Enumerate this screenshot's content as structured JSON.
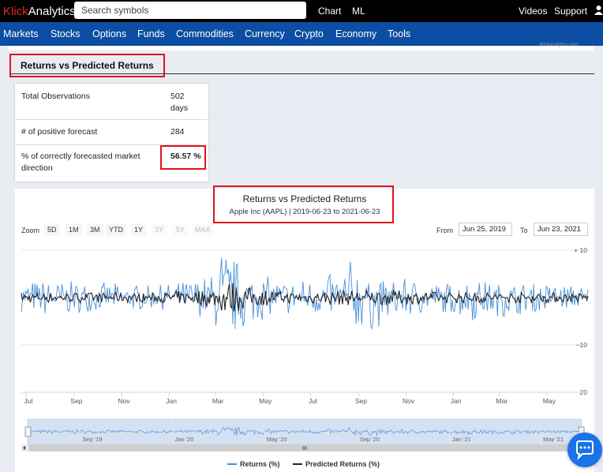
{
  "header": {
    "logo_prefix": "Klick",
    "logo_suffix": "Analytics",
    "search_placeholder": "Search symbols",
    "nav_chart": "Chart",
    "nav_ml": "ML",
    "nav_videos": "Videos",
    "nav_support": "Support",
    "brand_color": "#e0291b"
  },
  "menu": {
    "items": [
      "Markets",
      "Stocks",
      "Options",
      "Funds",
      "Commodities",
      "Currency",
      "Crypto",
      "Economy",
      "Tools"
    ],
    "bg_color": "#0b4ea3"
  },
  "watermark": "klickanalytics.com",
  "section": {
    "title": "Returns vs Predicted Returns"
  },
  "stats": {
    "rows": [
      {
        "label": "Total Observations",
        "value": "502 days"
      },
      {
        "label": "# of positive forecast",
        "value": "284"
      },
      {
        "label": "% of correctly forecasted market direction",
        "value": "56.57 %"
      }
    ]
  },
  "controls": {
    "zoom_label": "Zoom",
    "zoom_buttons": [
      "5D",
      "1M",
      "3M",
      "YTD",
      "1Y",
      "3Y",
      "5Y",
      "MAX"
    ],
    "from_label": "From",
    "from_date": "Jun 25, 2019",
    "to_label": "To",
    "to_date": "Jun 23, 2021"
  },
  "chart_data": {
    "type": "line",
    "title": "Returns vs Predicted Returns",
    "subtitle": "Apple Inc (AAPL) | 2019-06-23 to 2021-06-23",
    "xlabel": "",
    "ylabel": "",
    "ylim": [
      -20,
      12
    ],
    "y_ticks": [
      10,
      -10,
      -20
    ],
    "y_tick_labels": [
      "+ 10",
      "−10",
      "−20"
    ],
    "x_tick_labels": [
      "Jul",
      "Sep",
      "Nov",
      "Jan",
      "Mar",
      "May",
      "Jul",
      "Sep",
      "Nov",
      "Jan",
      "Mar",
      "May"
    ],
    "x_range": [
      "2019-06-25",
      "2021-06-23"
    ],
    "navigator_labels": [
      "Sep '19",
      "Jan '20",
      "May '20",
      "Sep '20",
      "Jan '21",
      "May '21"
    ],
    "grid": true,
    "legend_position": "bottom-center",
    "series": [
      {
        "name": "Returns (%)",
        "color": "#4a90d9",
        "envelope_dates": [
          "2019-07-01",
          "2019-08-05",
          "2019-09-15",
          "2019-11-01",
          "2019-12-15",
          "2020-01-31",
          "2020-02-27",
          "2020-03-09",
          "2020-03-13",
          "2020-03-16",
          "2020-03-23",
          "2020-04-15",
          "2020-05-15",
          "2020-06-15",
          "2020-07-31",
          "2020-09-03",
          "2020-09-08",
          "2020-10-15",
          "2020-11-15",
          "2020-12-15",
          "2021-01-27",
          "2021-02-25",
          "2021-03-15",
          "2021-04-15",
          "2021-05-15",
          "2021-06-20"
        ],
        "envelope_high": [
          4,
          3.5,
          3.5,
          3,
          2.5,
          4,
          5,
          12,
          11,
          10,
          9,
          6,
          4,
          4,
          5,
          10,
          3,
          4,
          4,
          3,
          4,
          3,
          3,
          3,
          3,
          2.5
        ],
        "envelope_low": [
          -3,
          -4.5,
          -3,
          -3,
          -2.5,
          -3,
          -6,
          -9,
          -13,
          -11,
          -9,
          -6,
          -3.5,
          -4,
          -4,
          -7,
          -8,
          -5,
          -4,
          -3,
          -5,
          -4,
          -4,
          -3,
          -3,
          -2
        ]
      },
      {
        "name": "Predicted Returns (%)",
        "color": "#222222",
        "envelope_dates": [
          "2019-07-01",
          "2019-12-15",
          "2020-02-27",
          "2020-03-16",
          "2020-04-15",
          "2020-06-15",
          "2020-09-08",
          "2020-12-15",
          "2021-03-15",
          "2021-06-20"
        ],
        "envelope_high": [
          1.2,
          1.0,
          2,
          4,
          2,
          1.2,
          1.8,
          1.2,
          1.2,
          1.0
        ],
        "envelope_low": [
          -1.2,
          -1.0,
          -2,
          -4,
          -2,
          -1.2,
          -1.8,
          -1.2,
          -1.2,
          -1.0
        ]
      }
    ]
  }
}
